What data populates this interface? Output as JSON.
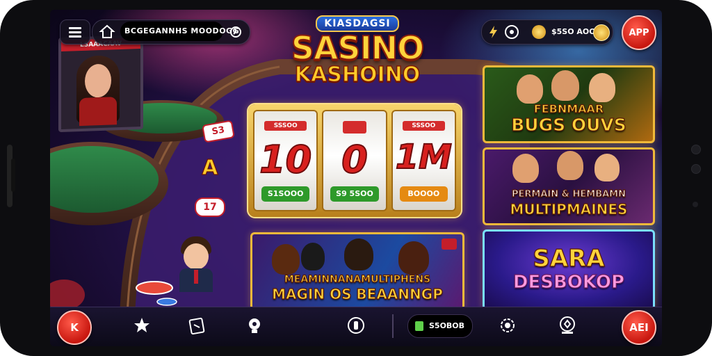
{
  "topbar": {
    "search_text": "BCGEGANNHS MOODOGG",
    "balance_text": "$5SO AOO",
    "app_button": "APP"
  },
  "logo": {
    "top": "KIASDAGSI",
    "main": "SASINO",
    "sub": "KASHOINO"
  },
  "slot": {
    "reel_values": [
      "10",
      "0",
      "1M"
    ],
    "reel_top_tags": [
      "SSSOO",
      "",
      "SSSOO"
    ],
    "reel_bottom_tags": [
      "S1SOOO",
      "S9 5SOO",
      "BOOOO"
    ],
    "reel_bottom_colors": [
      "#2e9a2a",
      "#2e9a2a",
      "#e58a12"
    ]
  },
  "side_chips": [
    "S3",
    "A",
    "17"
  ],
  "banners": {
    "center": {
      "line1": "MEAMINNANAMULTIPHENS",
      "line2": "MAGIN OS BEAANNGP"
    },
    "right1": {
      "line1": "FEBNMAAR",
      "line2": "BUGS OUVS"
    },
    "right2": {
      "line1": "PERMAIN & HEMBAMN",
      "line2": "MULTIPMAINES"
    },
    "right3": {
      "line1": "SARA",
      "line2": "DESBOKOP"
    }
  },
  "left_screen_label": "LSAAACAAV",
  "bottombar": {
    "left_button": "K",
    "coins_text": "S5OBOB",
    "right_button": "AEI"
  },
  "colors": {
    "accent_gold": "#f0b93a",
    "primary_red": "#d42c2c",
    "background_purple": "#26134f"
  }
}
